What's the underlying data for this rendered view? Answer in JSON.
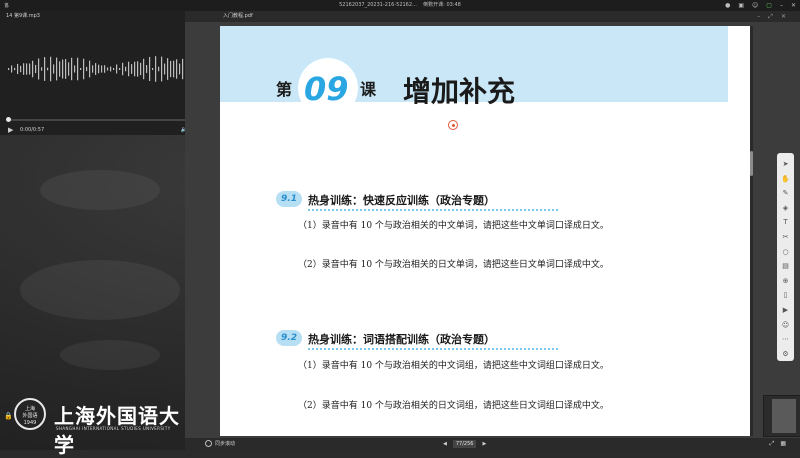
{
  "system_bar": {
    "window_title": "52162037_20231-216-52162...",
    "clock_label": "倒數开课: 03:48"
  },
  "player": {
    "file_name": "14 第9课.mp3",
    "time": "0:00/0:57",
    "progress": 0.0
  },
  "pdf": {
    "file_name": "入门教程.pdf",
    "lesson_prefix": "第",
    "lesson_number": "09",
    "lesson_suffix": "课",
    "lesson_title": "增加补充",
    "sections": [
      {
        "badge": "9.1",
        "title": "热身训练：快速反应训练（政治专题）",
        "items": [
          "（1）录音中有 10 个与政治相关的中文单词，请把这些中文单词口译成日文。",
          "（2）录音中有 10 个与政治相关的日文单词，请把这些日文单词口译成中文。"
        ]
      },
      {
        "badge": "9.2",
        "title": "热身训练：词语搭配训练（政治专题）",
        "items": [
          "（1）录音中有 10 个与政治相关的中文词组，请把这些中文词组口译成日文。",
          "（2）录音中有 10 个与政治相关的日文词组，请把这些日文词组口译成中文。"
        ]
      }
    ],
    "status": {
      "sync_label": "同步滚动",
      "current_page": "77",
      "total_pages": "/256"
    }
  },
  "logo": {
    "seal_line1": "上海",
    "seal_line2": "外国语",
    "seal_year": "1949",
    "name_cn": "上海外国语大学",
    "name_en": "SHANGHAI INTERNATIONAL STUDIES UNIVERSITY"
  },
  "colors": {
    "banner": "#c9e7f6",
    "accent_blue": "#2aa6e3",
    "badge_bg": "#b7dff3"
  }
}
